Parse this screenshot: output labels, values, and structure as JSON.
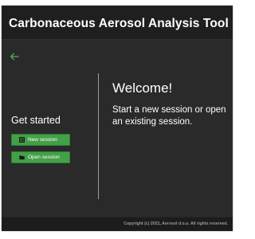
{
  "app": {
    "title": "Carbonaceous Aerosol Analysis Tool"
  },
  "nav": {
    "back_icon": "arrow-left-icon",
    "accent_color": "#4caf50"
  },
  "sidebar": {
    "heading": "Get started",
    "buttons": [
      {
        "label": "New session",
        "icon": "new-session-icon"
      },
      {
        "label": "Open session",
        "icon": "folder-icon"
      }
    ],
    "button_color": "#43a047"
  },
  "main": {
    "heading": "Welcome!",
    "text": "Start a new session or open an existing session."
  },
  "footer": {
    "copyright": "Copyright (c) 2021, Aerosol d.o.o. All rights reserved."
  }
}
